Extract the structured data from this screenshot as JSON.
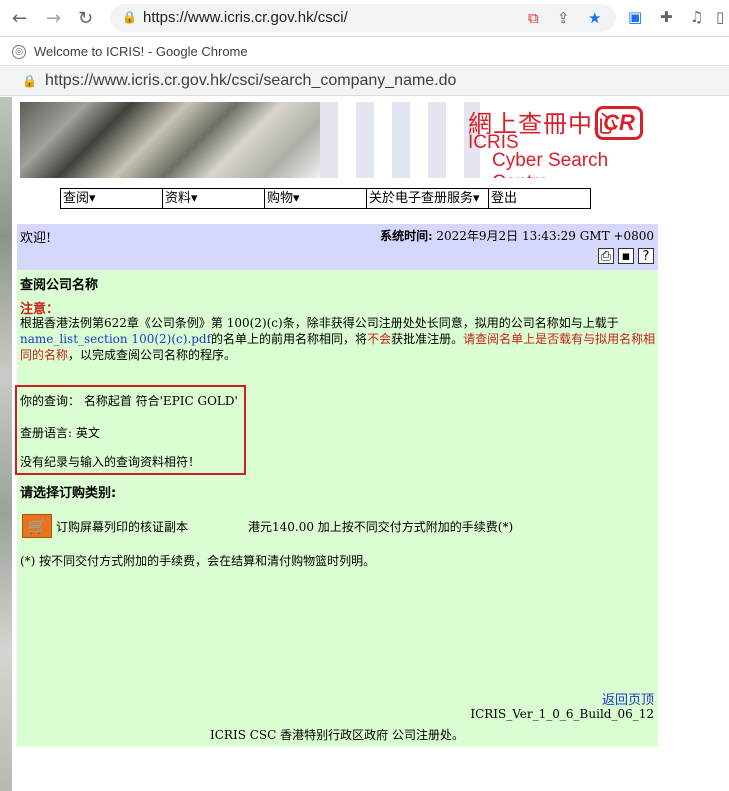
{
  "browser": {
    "back_glyph": "←",
    "forward_glyph": "→",
    "reload_glyph": "↻",
    "url": "https://www.icris.cr.gov.hk/csci/",
    "popup_title": "Welcome to ICRIS! - Google Chrome",
    "popup_url": "https://www.icris.cr.gov.hk/csci/search_company_name.do"
  },
  "banner": {
    "title_zh": "網上查冊中心",
    "title_en1": "ICRIS",
    "title_en2": "Cyber Search Centre",
    "logo_text": "CR"
  },
  "menu": [
    {
      "label": "查阅▾"
    },
    {
      "label": "资料▾"
    },
    {
      "label": "购物▾"
    },
    {
      "label": "关於电子查册服务▾"
    },
    {
      "label": "登出"
    }
  ],
  "welcome": {
    "greeting": "欢迎!",
    "time_label": "系统时间:",
    "time_value": "2022年9月2日 13:43:29 GMT +0800"
  },
  "page": {
    "heading": "查阅公司名称",
    "notice_label": "注意：",
    "para_line1": "根据香港法例第622章《公司条例》第 100(2)(c)条，除非获得公司注册处处长同意，拟用的公司名称如与上载于",
    "para_link": "name_list_section 100(2)(c).pdf",
    "para_line2a": "的名单上的前用名称相同，将",
    "para_red1": "不会",
    "para_line2b": "获批准注册。",
    "para_red2a": "请查阅名单上是否载有与拟用名称相",
    "para_red2b": "同的名称",
    "para_line3": "，以完成查阅公司名称的程序。",
    "query_line": "你的查询： 名称起首 符合'EPIC GOLD'",
    "language_line": "查册语言: 英文",
    "no_result_line": "没有纪录与输入的查询资料相符！",
    "order_title": "请选择订购类别:",
    "order_label": "订购屏幕列印的核证副本",
    "order_price": "港元140.00 加上按不同交付方式附加的手续费(*)",
    "footnote": "(*) 按不同交付方式附加的手续费，会在结算和清付购物篮时列明。",
    "back_to_top": "返回页顶",
    "version": "ICRIS_Ver_1_0_6_Build_06_12",
    "footer": "ICRIS CSC 香港特别行政区政府 公司注册处。"
  }
}
